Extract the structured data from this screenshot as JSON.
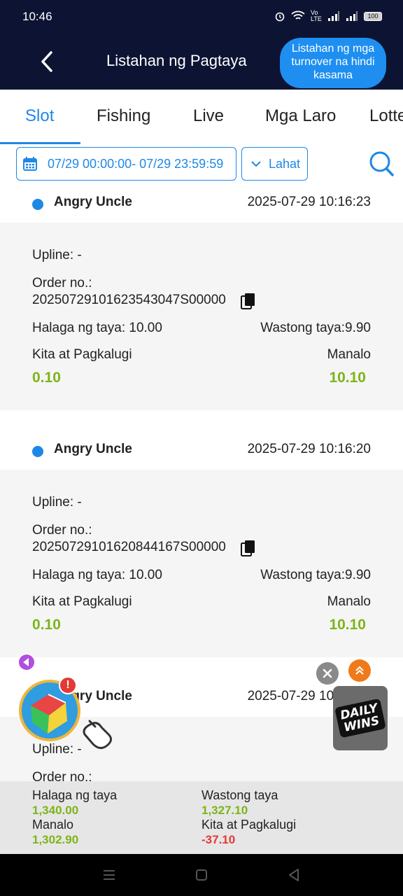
{
  "status_bar": {
    "time": "10:46",
    "network": "Vo LTE",
    "battery": "100"
  },
  "header": {
    "title": "Listahan ng Pagtaya",
    "turnover_button": "Listahan ng mga turnover na hindi kasama"
  },
  "tabs": [
    {
      "label": "Slot",
      "active": true
    },
    {
      "label": "Fishing",
      "active": false
    },
    {
      "label": "Live",
      "active": false
    },
    {
      "label": "Mga Laro",
      "active": false
    },
    {
      "label": "Lotte",
      "active": false
    }
  ],
  "filters": {
    "date_range": "07/29 00:00:00- 07/29 23:59:59",
    "category": "Lahat"
  },
  "bets": [
    {
      "game": "Angry Uncle",
      "datetime": "2025-07-29 10:16:23",
      "upline": "Upline: -",
      "order_label": "Order no.:",
      "order_no": "20250729101623543047S00000",
      "bet_amount": "Halaga ng taya: 10.00",
      "valid_bet": "Wastong taya:9.90",
      "profit_label": "Kita at Pagkalugi",
      "profit_value": "0.10",
      "win_label": "Manalo",
      "win_value": "10.10"
    },
    {
      "game": "Angry Uncle",
      "datetime": "2025-07-29 10:16:20",
      "upline": "Upline: -",
      "order_label": "Order no.:",
      "order_no": "20250729101620844167S00000",
      "bet_amount": "Halaga ng taya: 10.00",
      "valid_bet": "Wastong taya:9.90",
      "profit_label": "Kita at Pagkalugi",
      "profit_value": "0.10",
      "win_label": "Manalo",
      "win_value": "10.10"
    },
    {
      "game": "Angry Uncle",
      "datetime": "2025-07-29 10:16:17",
      "upline": "Upline: -",
      "order_label": "Order no.:"
    }
  ],
  "summary": {
    "bet_label": "Halaga ng taya",
    "bet_value": "1,340.00",
    "valid_label": "Wastong taya",
    "valid_value": "1,327.10",
    "win_label": "Manalo",
    "win_value": "1,302.90",
    "profit_label": "Kita at Pagkalugi",
    "profit_value": "-37.10"
  },
  "promo": {
    "badge": "!",
    "daily_wins": "DAILY WINS"
  },
  "colors": {
    "header_bg": "#0d1433",
    "accent": "#1e88e5",
    "positive": "#7cb518",
    "negative": "#e53935"
  }
}
